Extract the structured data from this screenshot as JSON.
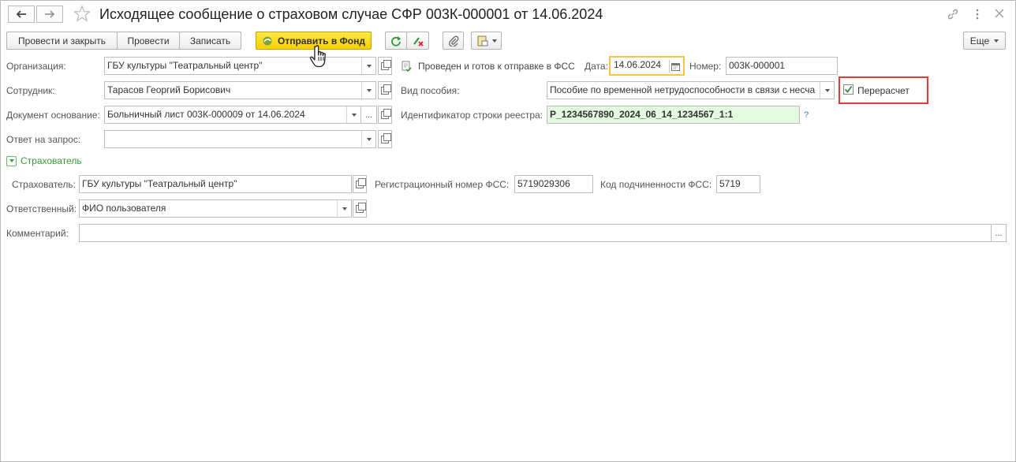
{
  "window": {
    "title": "Исходящее сообщение о страховом случае СФР 003К-000001 от 14.06.2024"
  },
  "toolbar": {
    "post_close": "Провести и закрыть",
    "post": "Провести",
    "save": "Записать",
    "send": "Отправить в Фонд",
    "more": "Еще"
  },
  "status": {
    "text": "Проведен и готов к отправке в ФСС"
  },
  "form": {
    "org_label": "Организация:",
    "org_value": "ГБУ культуры \"Театральный центр\"",
    "date_label": "Дата:",
    "date_value": "14.06.2024",
    "number_label": "Номер:",
    "number_value": "003К-000001",
    "employee_label": "Сотрудник:",
    "employee_value": "Тарасов Георгий Борисович",
    "benefit_label": "Вид пособия:",
    "benefit_value": "Пособие по временной нетрудоспособности в связи с несча",
    "recalc_label": "Перерасчет",
    "recalc_checked": true,
    "basis_label": "Документ основание:",
    "basis_value": "Больничный лист 003К-000009 от 14.06.2024",
    "registry_label": "Идентификатор строки реестра:",
    "registry_value": "P_1234567890_2024_06_14_1234567_1:1",
    "help": "?",
    "reply_label": "Ответ на запрос:",
    "reply_value": ""
  },
  "insurer_section": {
    "header": "Страхователь",
    "insurer_label": "Страхователь:",
    "insurer_value": "ГБУ культуры \"Театральный центр\"",
    "reg_label": "Регистрационный номер ФСС:",
    "reg_value": "5719029306",
    "sub_label": "Код подчиненности ФСС:",
    "sub_value": "5719",
    "resp_label": "Ответственный:",
    "resp_value": "ФИО пользователя",
    "comment_label": "Комментарий:",
    "comment_value": ""
  },
  "colors": {
    "accent_yellow": "#f7cf00",
    "section_green": "#3a9b3a",
    "highlight_red": "#e53b3b",
    "field_green_bg": "#e3f9e0"
  },
  "icons": [
    "back-arrow-icon",
    "forward-arrow-icon",
    "star-icon",
    "link-icon",
    "kebab-icon",
    "close-icon",
    "refresh-icon",
    "clear-posting-icon",
    "paperclip-icon",
    "print-icon",
    "posted-document-icon",
    "calendar-icon",
    "hand-cursor-icon"
  ]
}
